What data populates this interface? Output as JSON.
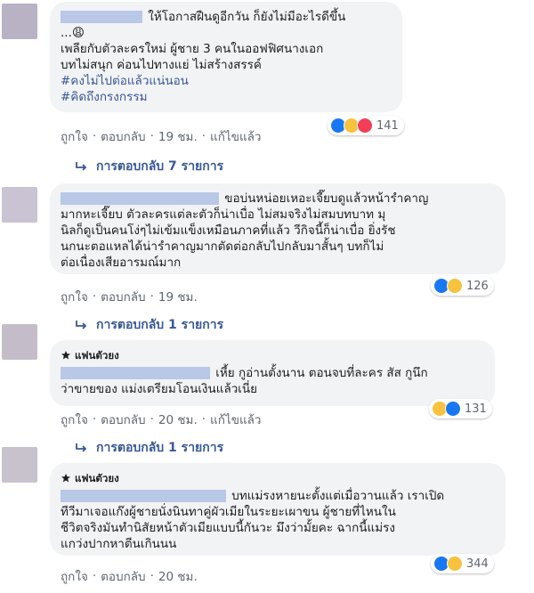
{
  "actions": {
    "like": "ถูกใจ",
    "reply": "ตอบกลับ",
    "edited": "แก้ไขแล้ว"
  },
  "comments": [
    {
      "lines": [
        "ให้โอกาสฝืนดูอีกวัน ก็ยังไม่มีอะไรดีขึ้น",
        "...😩",
        "เพลียกับตัวละครใหม่ ผู้ชาย 3 คนในออฟฟิศนางเอก",
        "บทไม่สนุก ค่อนไปทางแย่ ไม่สร้างสรรค์"
      ],
      "hashtags": [
        "#คงไม่ไปต่อแล้วแน่นอน",
        "#คิดถึงกรงกรรม"
      ],
      "reaction_count": "141",
      "time": "19 ชม.",
      "edited": true,
      "replies_label": "การตอบกลับ 7 รายการ"
    },
    {
      "lines": [
        "ขอบ่นหน่อยเหอะเจี๊ยบดูแล้วหน้ารำคาญ",
        "มากหะเจี๊ยบ ตัวละครแต่ละตัวก็น่าเบื่อ ไม่สมจริงไม่สมบทบาท มุ",
        "นิลก็ดูเป็นคนโง่ๆไม่เข้มแข็งเหมือนภาคที่แล้ว วีกิจนี้ก็น่าเบื่อ ยิ่งรัช",
        "นกนะตอแหลได้น่ารำคาญมากตัดต่อกลับไปกลับมาสั้นๆ บทก็ไม่",
        "ต่อเนื่องเสียอารมณ์มาก"
      ],
      "reaction_count": "126",
      "time": "19 ชม.",
      "edited": false,
      "replies_label": "การตอบกลับ 1 รายการ"
    },
    {
      "badge": "แฟนตัวยง",
      "lines": [
        "เหี้ย กูอ่านตั้งนาน ตอนจบที่ละคร สัส กูนึก",
        "ว่าขายของ แม่งเตรียมโอนเงินแล้วเนี่ย"
      ],
      "reaction_count": "131",
      "time": "20 ชม.",
      "edited": true,
      "replies_label": "การตอบกลับ 1 รายการ"
    },
    {
      "badge": "แฟนตัวยง",
      "lines": [
        "บทแม่รงหายนะตั้งแต่เมื่อวานแล้ว เราเปิด",
        "ทีวีมาเจอแก๊งผู้ชายนั่งนินทาคู่ผัวเมียในระยะเผาขน ผู้ชายที่ไหนใน",
        "ชีวิตจริงมันทำนิสัยหน้าตัวเมียแบบนี้กันวะ มึงว่ามั้ยคะ ฉากนี้แม่รง",
        "แกว่งปากหาตีนเกินนน"
      ],
      "reaction_count": "344",
      "time": "20 ชม.",
      "edited": false
    }
  ],
  "colors": {
    "link": "#385898",
    "muted": "#606770",
    "bubble": "#f2f3f5",
    "like_blue": "#1877f2",
    "haha_yellow": "#f7c23d",
    "love_red": "#f33e58"
  },
  "icons": {
    "reply_arrow": "reply-arrow-icon",
    "like": "like-reaction-icon",
    "haha": "haha-reaction-icon",
    "love": "love-reaction-icon",
    "fan_badge": "fan-badge-icon"
  }
}
